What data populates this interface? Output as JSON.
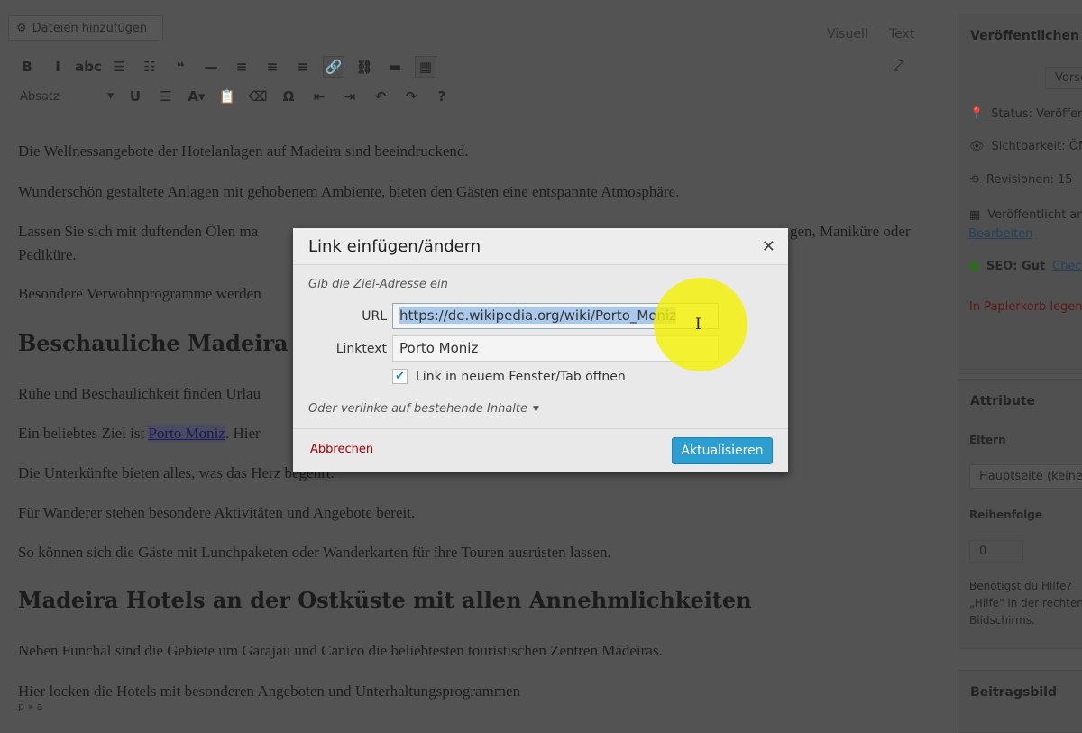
{
  "toolbar": {
    "add_media": "Dateien hinzufügen",
    "tab_visual": "Visuell",
    "tab_text": "Text",
    "format_select": "Absatz",
    "row1": [
      {
        "name": "bold",
        "g": "B"
      },
      {
        "name": "italic",
        "g": "I"
      },
      {
        "name": "strikethrough",
        "g": "abc"
      },
      {
        "name": "bullet-list",
        "g": "☰"
      },
      {
        "name": "numbered-list",
        "g": "☷"
      },
      {
        "name": "blockquote",
        "g": "❝"
      },
      {
        "name": "horizontal-line",
        "g": "—"
      },
      {
        "name": "align-left",
        "g": "≡"
      },
      {
        "name": "align-center",
        "g": "≡"
      },
      {
        "name": "align-right",
        "g": "≡"
      },
      {
        "name": "insert-link",
        "g": "🔗"
      },
      {
        "name": "remove-link",
        "g": "⛓"
      },
      {
        "name": "read-more",
        "g": "▬"
      },
      {
        "name": "toolbar-toggle",
        "g": "▦"
      }
    ],
    "row2": [
      {
        "name": "underline",
        "g": "U"
      },
      {
        "name": "justify",
        "g": "☰"
      },
      {
        "name": "text-color",
        "g": "A▾"
      },
      {
        "name": "paste-text",
        "g": "📋"
      },
      {
        "name": "clear-format",
        "g": "⌫"
      },
      {
        "name": "special-char",
        "g": "Ω"
      },
      {
        "name": "outdent",
        "g": "⇤"
      },
      {
        "name": "indent",
        "g": "⇥"
      },
      {
        "name": "undo",
        "g": "↶"
      },
      {
        "name": "redo",
        "g": "↷"
      },
      {
        "name": "help",
        "g": "?"
      }
    ]
  },
  "editor": {
    "p1": "Die Wellnessangebote der Hotelanlagen auf Madeira sind beeindruckend.",
    "p2": "Wunderschön gestaltete Anlagen mit gehobenem Ambiente, bieten den Gästen eine entspannte Atmosphäre.",
    "p3a": "Lassen Sie sich mit duftenden Ölen ma",
    "p3b": "gen, Maniküre oder",
    "p3c": "Pediküre.",
    "p4": "Besondere Verwöhnprogramme werden",
    "h1": "Beschauliche Madeira",
    "p5": "Ruhe und Beschaulichkeit finden Urlau",
    "p6a": "Ein beliebtes Ziel ist ",
    "p6link": "Porto Moniz",
    "p6b": ". Hier",
    "p7": "Die Unterkünfte bieten alles, was das Herz begehrt.",
    "p8": "Für Wanderer stehen besondere Aktivitäten und Angebote bereit.",
    "p9": "So können sich die Gäste mit Lunchpaketen oder Wanderkarten für ihre Touren ausrüsten lassen.",
    "h2": "Madeira Hotels an der Ostküste mit allen Annehmlichkeiten",
    "p10": "Neben Funchal sind die Gebiete um Garajau und Canico die beliebtesten touristischen Zentren Madeiras.",
    "p11": "Hier locken die Hotels mit besonderen Angeboten und Unterhaltungsprogrammen",
    "path": "p » a"
  },
  "sidebar": {
    "publish": {
      "title": "Veröffentlichen",
      "preview": "Vorschau",
      "status": "Status: Veröffentlicht",
      "visibility": "Sichtbarkeit: Öffentlich",
      "revisions": "Revisionen: 15",
      "published": "Veröffentlicht am",
      "edit": "Bearbeiten",
      "seo": "SEO: Gut",
      "seo_link": "Check",
      "trash": "In Papierkorb legen"
    },
    "attributes": {
      "title": "Attribute",
      "parent_label": "Eltern",
      "parent_value": "Hauptseite (keine Eltern)",
      "order_label": "Reihenfolge",
      "order_value": "0",
      "help1": "Benötigst du Hilfe?",
      "help2": "„Hilfe\" in der rechten",
      "help3": "Bildschirms."
    },
    "thumbnail": {
      "title": "Beitragsbild"
    }
  },
  "dialog": {
    "title": "Link einfügen/ändern",
    "hint": "Gib die Ziel-Adresse ein",
    "url_label": "URL",
    "url_value": "https://de.wikipedia.org/wiki/Porto_Moniz",
    "text_label": "Linktext",
    "text_value": "Porto Moniz",
    "new_tab_label": "Link in neuem Fenster/Tab öffnen",
    "new_tab_checked": true,
    "existing": "Oder verlinke auf bestehende Inhalte",
    "cancel": "Abbrechen",
    "update": "Aktualisieren"
  },
  "colors": {
    "accent": "#2c9ed2",
    "cancel": "#a00000",
    "highlight": "#f4f000"
  }
}
